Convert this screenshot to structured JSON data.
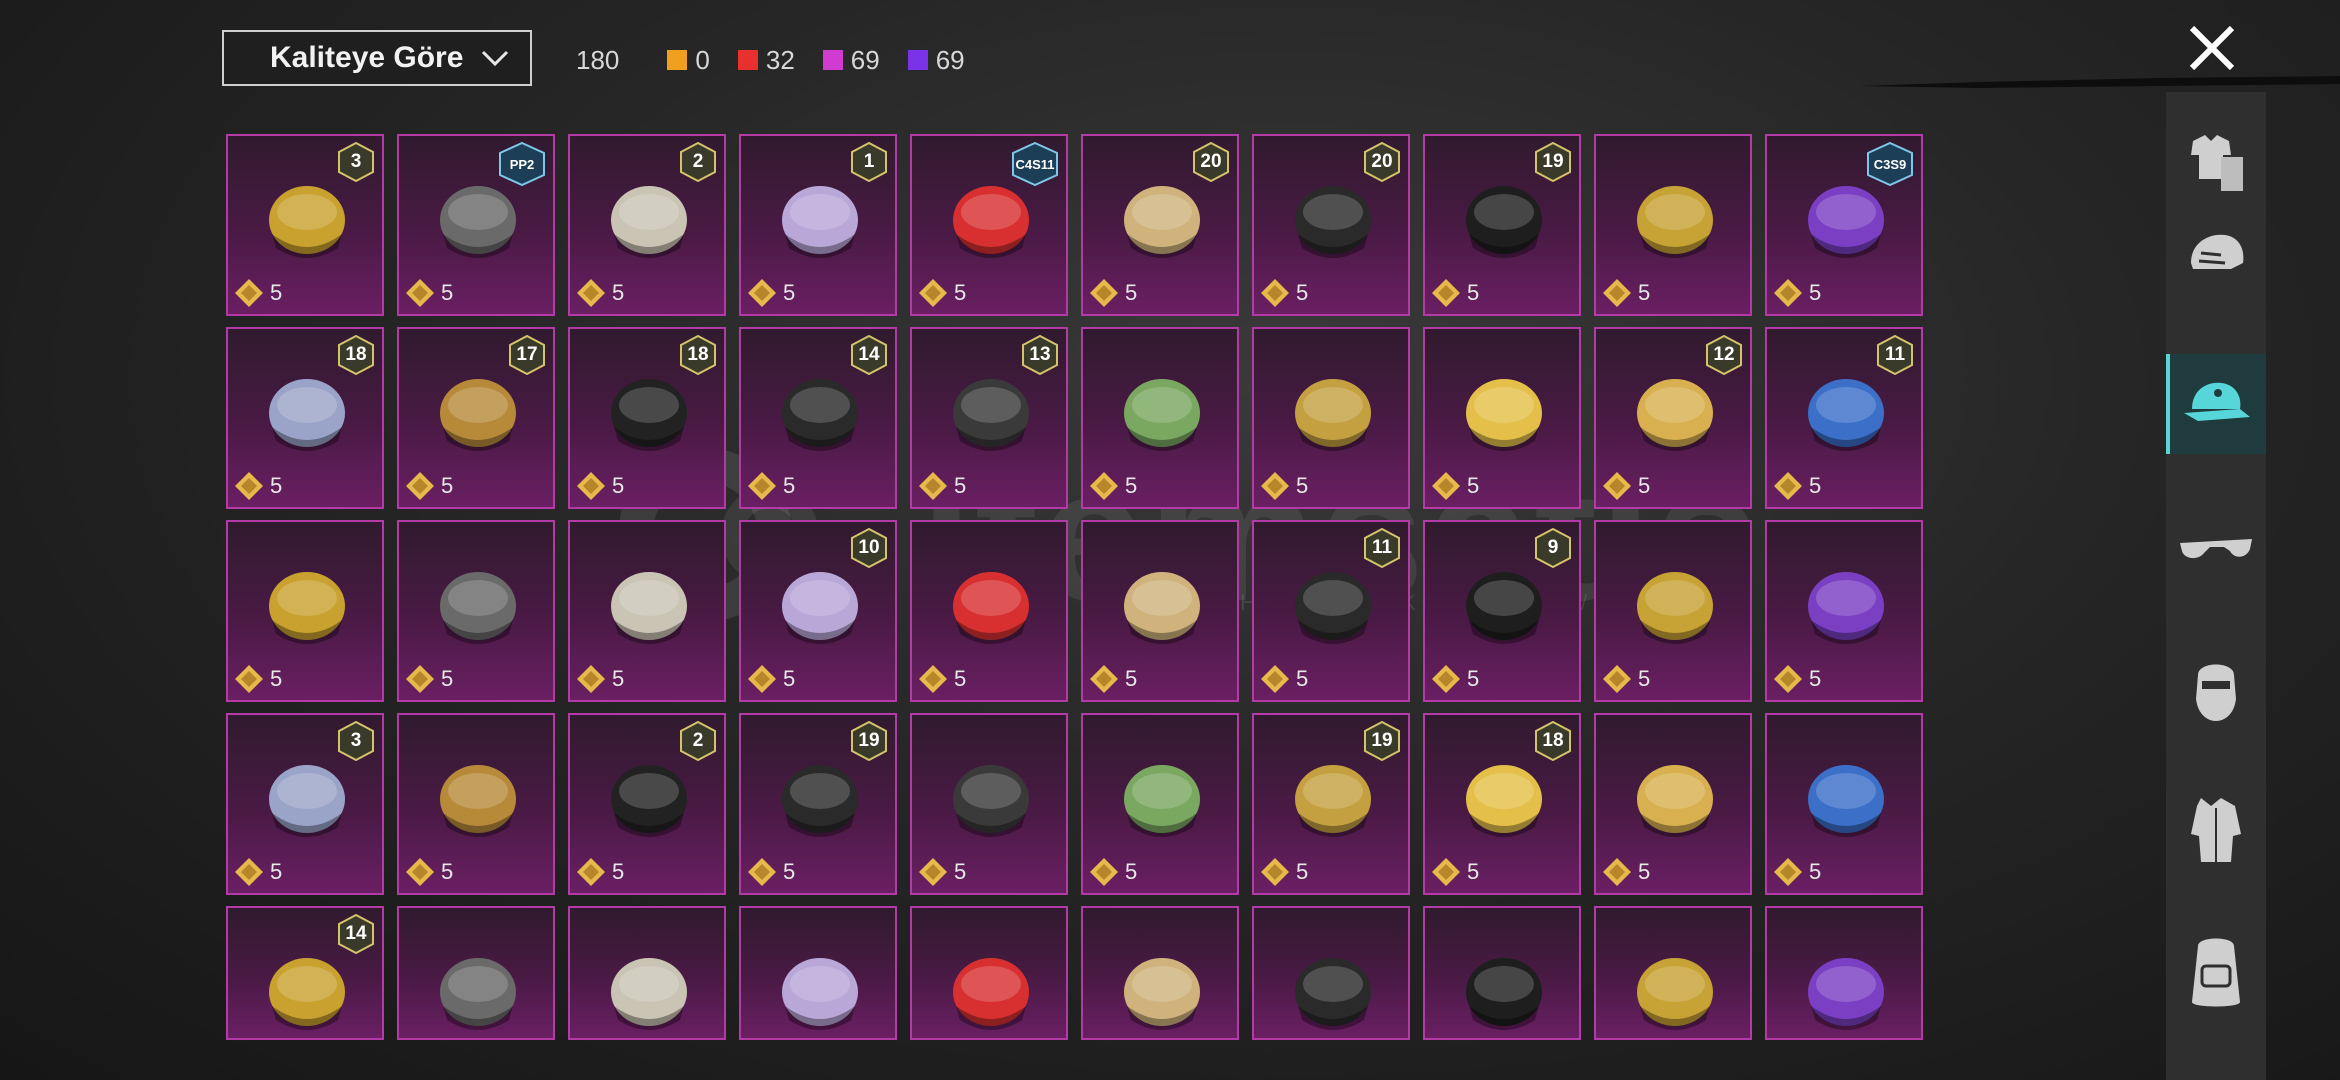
{
  "toolbar": {
    "sort_label": "Kaliteye Göre",
    "total_count": "180",
    "rarity_counts": [
      {
        "name": "legendary",
        "value": "0",
        "color": "#f0a01e"
      },
      {
        "name": "epic",
        "value": "32",
        "color": "#e8312f"
      },
      {
        "name": "rare-pink",
        "value": "69",
        "color": "#d23bd0"
      },
      {
        "name": "rare-purple",
        "value": "69",
        "color": "#7a33e8"
      }
    ]
  },
  "watermark": {
    "text": "itemsatis",
    "sub": "HESAP / SKIN / İTEM / E-PIN"
  },
  "sidebar": {
    "items": [
      {
        "icon": "outfit-icon"
      },
      {
        "icon": "helmet-icon"
      },
      {
        "icon": "cap-icon",
        "active": true
      },
      {
        "icon": "glasses-icon"
      },
      {
        "icon": "mask-icon"
      },
      {
        "icon": "jacket-icon"
      },
      {
        "icon": "backpack-icon"
      }
    ]
  },
  "items": [
    {
      "badge": "3",
      "price": "5",
      "icon": "jester-hat-icon"
    },
    {
      "badge": "PP2",
      "price": "5",
      "icon": "black-cat-mask-icon"
    },
    {
      "badge": "2",
      "price": "5",
      "icon": "blonde-hair-bandana-icon"
    },
    {
      "badge": "1",
      "price": "5",
      "icon": "pastel-hair-icon"
    },
    {
      "badge": "C4S11",
      "price": "5",
      "icon": "red-cap-icon"
    },
    {
      "badge": "20",
      "price": "5",
      "icon": "bunny-ears-hair-icon"
    },
    {
      "badge": "20",
      "price": "5",
      "icon": "gold-trim-helmet-icon"
    },
    {
      "badge": "19",
      "price": "5",
      "icon": "black-hair-icon"
    },
    {
      "badge": "",
      "price": "5",
      "icon": "golden-dragon-helmet-icon"
    },
    {
      "badge": "C3S9",
      "price": "5",
      "icon": "purple-beret-icon"
    },
    {
      "badge": "18",
      "price": "5",
      "icon": "silver-hair-crown-icon"
    },
    {
      "badge": "17",
      "price": "5",
      "icon": "antler-mask-icon"
    },
    {
      "badge": "18",
      "price": "5",
      "icon": "black-shaggy-hair-icon"
    },
    {
      "badge": "14",
      "price": "5",
      "icon": "headband-hair-icon"
    },
    {
      "badge": "13",
      "price": "5",
      "icon": "devil-horns-helmet-icon"
    },
    {
      "badge": "",
      "price": "5",
      "icon": "green-frill-hat-icon"
    },
    {
      "badge": "",
      "price": "5",
      "icon": "feather-headdress-icon"
    },
    {
      "badge": "",
      "price": "5",
      "icon": "duck-helmet-icon"
    },
    {
      "badge": "12",
      "price": "5",
      "icon": "cylinder-head-icon"
    },
    {
      "badge": "11",
      "price": "5",
      "icon": "blue-beanie-icon"
    },
    {
      "badge": "",
      "price": "5",
      "icon": "silver-spike-helmet-icon"
    },
    {
      "badge": "",
      "price": "5",
      "icon": "wrapped-headpiece-icon"
    },
    {
      "badge": "",
      "price": "5",
      "icon": "horned-black-helmet-icon"
    },
    {
      "badge": "10",
      "price": "5",
      "icon": "pink-helmet-icon"
    },
    {
      "badge": "",
      "price": "5",
      "icon": "golden-crown-icon"
    },
    {
      "badge": "",
      "price": "5",
      "icon": "brass-hat-icon"
    },
    {
      "badge": "11",
      "price": "5",
      "icon": "dark-armor-hat-icon"
    },
    {
      "badge": "9",
      "price": "5",
      "icon": "jellyfish-helmet-icon"
    },
    {
      "badge": "",
      "price": "5",
      "icon": "spiked-gold-helmet-icon"
    },
    {
      "badge": "",
      "price": "5",
      "icon": "kendo-helmet-icon"
    },
    {
      "badge": "3",
      "price": "5",
      "icon": "ufo-hat-icon"
    },
    {
      "badge": "",
      "price": "5",
      "icon": "silver-hair-icon"
    },
    {
      "badge": "2",
      "price": "5",
      "icon": "predator-mask-icon"
    },
    {
      "badge": "19",
      "price": "5",
      "icon": "cat-ear-headphones-icon"
    },
    {
      "badge": "",
      "price": "5",
      "icon": "topknot-hair-icon"
    },
    {
      "badge": "",
      "price": "5",
      "icon": "doll-head-icon"
    },
    {
      "badge": "19",
      "price": "5",
      "icon": "bug-eye-helmet-icon"
    },
    {
      "badge": "18",
      "price": "5",
      "icon": "pink-police-cap-icon"
    },
    {
      "badge": "",
      "price": "5",
      "icon": "lion-mask-icon"
    },
    {
      "badge": "",
      "price": "5",
      "icon": "dino-hat-icon"
    },
    {
      "badge": "14",
      "price": "",
      "icon": "officer-cap-icon"
    },
    {
      "badge": "",
      "price": "",
      "icon": "witch-hat-icon"
    },
    {
      "badge": "",
      "price": "",
      "icon": "dreadlock-mask-icon"
    },
    {
      "badge": "",
      "price": "",
      "icon": "frog-hat-icon"
    },
    {
      "badge": "",
      "price": "",
      "icon": "gas-mask-icon"
    },
    {
      "badge": "",
      "price": "",
      "icon": "visor-helmet-icon"
    },
    {
      "badge": "",
      "price": "",
      "icon": "riot-helmet-icon"
    },
    {
      "badge": "",
      "price": "",
      "icon": "heart-headband-icon"
    },
    {
      "badge": "",
      "price": "",
      "icon": "black-feather-icon"
    },
    {
      "badge": "",
      "price": "",
      "icon": "skull-balaclava-icon"
    }
  ]
}
